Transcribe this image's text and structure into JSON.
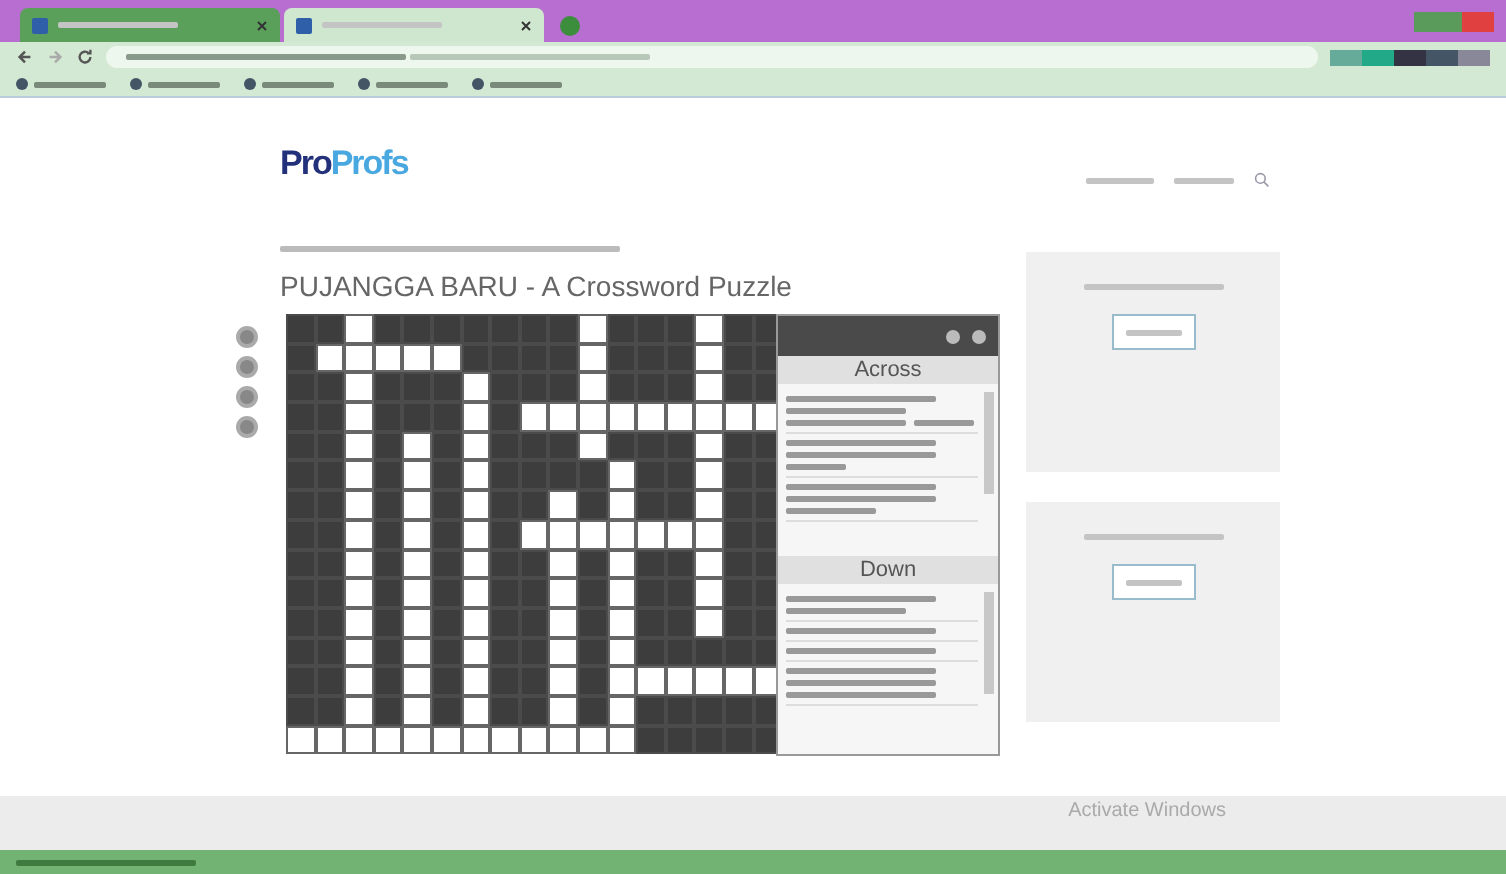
{
  "browser": {
    "tabs": [
      {
        "selected": false
      },
      {
        "selected": true
      }
    ]
  },
  "logo": {
    "pro": "Pro",
    "profs": "Profs"
  },
  "page_title": "PUJANGGA BARU - A Crossword Puzzle",
  "crossword": {
    "grid": [
      [
        false,
        false,
        true,
        false,
        false,
        false,
        false,
        false,
        false,
        false,
        true,
        false,
        false,
        false,
        true,
        false,
        false
      ],
      [
        false,
        true,
        true,
        true,
        true,
        true,
        false,
        false,
        false,
        false,
        true,
        false,
        false,
        false,
        true,
        false,
        false
      ],
      [
        false,
        false,
        true,
        false,
        false,
        false,
        true,
        false,
        false,
        false,
        true,
        false,
        false,
        false,
        true,
        false,
        false
      ],
      [
        false,
        false,
        true,
        false,
        false,
        false,
        true,
        false,
        true,
        true,
        true,
        true,
        true,
        true,
        true,
        true,
        true
      ],
      [
        false,
        false,
        true,
        false,
        true,
        false,
        true,
        false,
        false,
        false,
        true,
        false,
        false,
        false,
        true,
        false,
        false
      ],
      [
        false,
        false,
        true,
        false,
        true,
        false,
        true,
        false,
        false,
        false,
        false,
        true,
        false,
        false,
        true,
        false,
        false
      ],
      [
        false,
        false,
        true,
        false,
        true,
        false,
        true,
        false,
        false,
        true,
        false,
        true,
        false,
        false,
        true,
        false,
        false
      ],
      [
        false,
        false,
        true,
        false,
        true,
        false,
        true,
        false,
        true,
        true,
        true,
        true,
        true,
        true,
        true,
        false,
        false
      ],
      [
        false,
        false,
        true,
        false,
        true,
        false,
        true,
        false,
        false,
        true,
        false,
        true,
        false,
        false,
        true,
        false,
        false
      ],
      [
        false,
        false,
        true,
        false,
        true,
        false,
        true,
        false,
        false,
        true,
        false,
        true,
        false,
        false,
        true,
        false,
        false
      ],
      [
        false,
        false,
        true,
        false,
        true,
        false,
        true,
        false,
        false,
        true,
        false,
        true,
        false,
        false,
        true,
        false,
        false
      ],
      [
        false,
        false,
        true,
        false,
        true,
        false,
        true,
        false,
        false,
        true,
        false,
        true,
        false,
        false,
        false,
        false,
        false
      ],
      [
        false,
        false,
        true,
        false,
        true,
        false,
        true,
        false,
        false,
        true,
        false,
        true,
        true,
        true,
        true,
        true,
        true
      ],
      [
        false,
        false,
        true,
        false,
        true,
        false,
        true,
        false,
        false,
        true,
        false,
        true,
        false,
        false,
        false,
        false,
        false
      ],
      [
        true,
        true,
        true,
        true,
        true,
        true,
        true,
        true,
        true,
        true,
        true,
        true,
        false,
        false,
        false,
        false,
        false
      ]
    ],
    "across_heading": "Across",
    "down_heading": "Down"
  },
  "activation": {
    "title": "Activate Windows"
  }
}
